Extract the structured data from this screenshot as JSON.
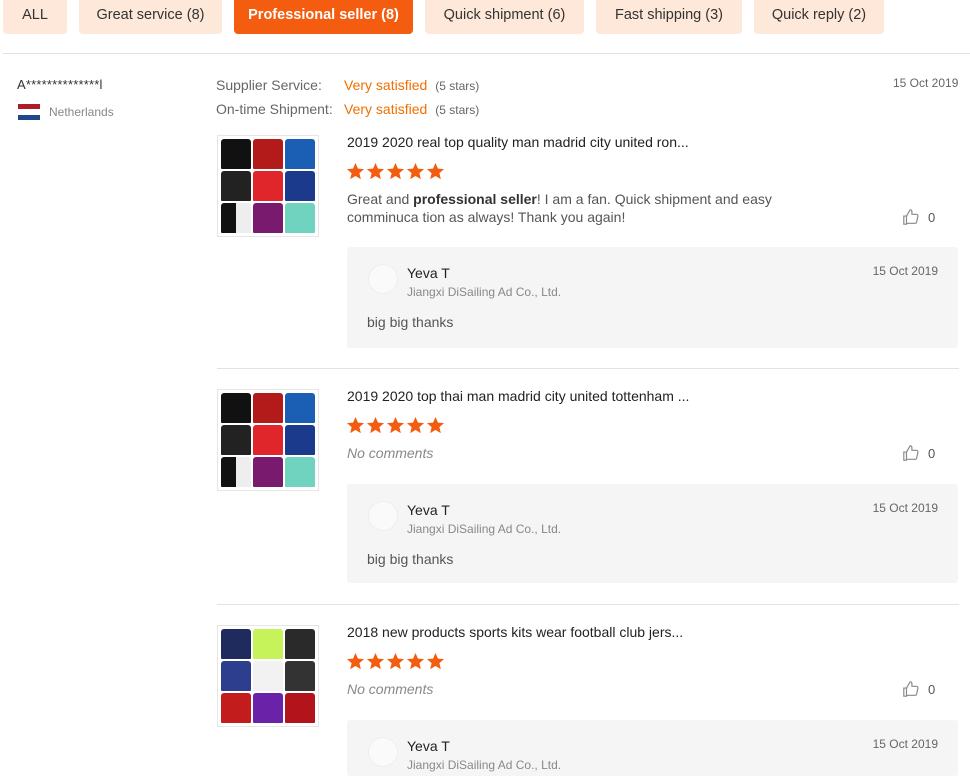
{
  "tags": [
    {
      "label": "ALL",
      "active": false
    },
    {
      "label": "Great service (8)",
      "active": false
    },
    {
      "label": "Professional seller (8)",
      "active": true
    },
    {
      "label": "Quick shipment (6)",
      "active": false
    },
    {
      "label": "Fast shipping (3)",
      "active": false
    },
    {
      "label": "Quick reply (2)",
      "active": false
    }
  ],
  "buyer": {
    "name": "A**************l",
    "country": "Netherlands"
  },
  "ratings": {
    "supplier_label": "Supplier Service:",
    "supplier_value": "Very satisfied",
    "supplier_stars": "(5 stars)",
    "shipment_label": "On-time Shipment:",
    "shipment_value": "Very satisfied",
    "shipment_stars": "(5 stars)"
  },
  "review_date": "15 Oct 2019",
  "colors": {
    "accent": "#f45d0f",
    "tag_bg": "#fde8d9",
    "star": "#f45d0f",
    "satisfied": "#f07000"
  },
  "items": [
    {
      "title": "2019 2020 real top quality man madrid city united ron...",
      "rating": 5,
      "comment_pre": "Great and ",
      "comment_bold": "professional seller",
      "comment_post": "! I am a fan. Quick shipment and easy comminuca tion as always! Thank you again!",
      "no_comment": "",
      "likes": "0",
      "reply": {
        "name": "Yeva T",
        "company": "Jiangxi DiSailing Ad Co., Ltd.",
        "date": "15 Oct 2019",
        "text": "big big thanks"
      }
    },
    {
      "title": "2019 2020 top thai man madrid city united tottenham ...",
      "rating": 5,
      "comment_pre": "",
      "comment_bold": "",
      "comment_post": "",
      "no_comment": "No comments",
      "likes": "0",
      "reply": {
        "name": "Yeva T",
        "company": "Jiangxi DiSailing Ad Co., Ltd.",
        "date": "15 Oct 2019",
        "text": "big big thanks"
      }
    },
    {
      "title": "2018 new products sports kits wear football club jers...",
      "rating": 5,
      "comment_pre": "",
      "comment_bold": "",
      "comment_post": "",
      "no_comment": "No comments",
      "likes": "0",
      "reply": {
        "name": "Yeva T",
        "company": "Jiangxi DiSailing Ad Co., Ltd.",
        "date": "15 Oct 2019",
        "text": ""
      }
    }
  ]
}
